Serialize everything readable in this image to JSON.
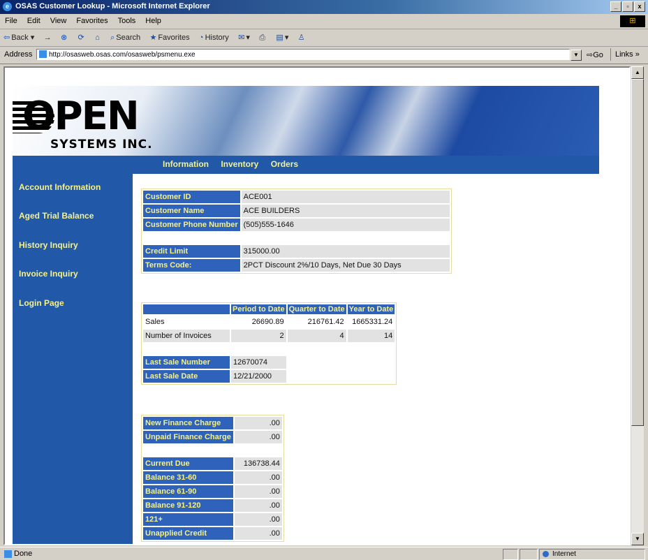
{
  "window": {
    "title": "OSAS Customer Lookup - Microsoft Internet Explorer",
    "buttons": [
      "_",
      "▫",
      "x"
    ]
  },
  "menu": [
    "File",
    "Edit",
    "View",
    "Favorites",
    "Tools",
    "Help"
  ],
  "toolbar": {
    "back": "Back",
    "forward": "→",
    "search": "Search",
    "favorites": "Favorites",
    "history": "History"
  },
  "address": {
    "label": "Address",
    "url": "http://osasweb.osas.com/osasweb/psmenu.exe",
    "go": "Go",
    "links": "Links »"
  },
  "banner": {
    "logo_word": "OPEN",
    "logo_sub": "SYSTEMS INC."
  },
  "nav_tabs": [
    "Information",
    "Inventory",
    "Orders"
  ],
  "sidebar": {
    "items": [
      "Account Information",
      "Aged Trial Balance",
      "History Inquiry",
      "Invoice Inquiry",
      "Login Page"
    ]
  },
  "customer": {
    "rows": [
      {
        "label": "Customer ID",
        "value": "ACE001"
      },
      {
        "label": "Customer Name",
        "value": "ACE BUILDERS"
      },
      {
        "label": "Customer Phone Number",
        "value": "(505)555-1646"
      },
      {
        "label": "Credit Limit",
        "value": "315000.00"
      },
      {
        "label": "Terms Code:",
        "value": "2PCT Discount 2%/10 Days, Net Due 30 Days"
      }
    ]
  },
  "sales": {
    "headers": [
      "Period to Date",
      "Quarter to Date",
      "Year to Date"
    ],
    "rows": [
      {
        "label": "Sales",
        "values": [
          "26690.89",
          "216761.42",
          "1665331.24"
        ]
      },
      {
        "label": "Number of Invoices",
        "values": [
          "2",
          "4",
          "14"
        ]
      }
    ],
    "last_sale_number_label": "Last Sale Number",
    "last_sale_number": "12670074",
    "last_sale_date_label": "Last Sale Date",
    "last_sale_date": "12/21/2000"
  },
  "finance": {
    "rows_top": [
      {
        "label": "New Finance Charge",
        "value": ".00"
      },
      {
        "label": "Unpaid Finance Charge",
        "value": ".00"
      }
    ],
    "rows_bottom": [
      {
        "label": "Current Due",
        "value": "136738.44"
      },
      {
        "label": "Balance 31-60",
        "value": ".00"
      },
      {
        "label": "Balance 61-90",
        "value": ".00"
      },
      {
        "label": "Balance 91-120",
        "value": ".00"
      },
      {
        "label": "121+",
        "value": ".00"
      },
      {
        "label": "Unapplied Credit",
        "value": ".00"
      }
    ]
  },
  "status": {
    "text": "Done",
    "zone": "Internet"
  }
}
